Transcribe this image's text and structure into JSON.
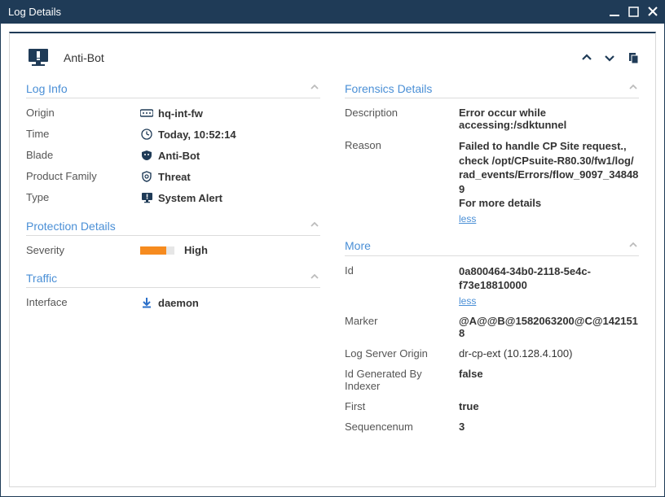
{
  "window": {
    "title": "Log Details"
  },
  "header": {
    "title": "Anti-Bot"
  },
  "sections": {
    "log_info": {
      "title": "Log Info",
      "origin_label": "Origin",
      "origin_value": "hq-int-fw",
      "time_label": "Time",
      "time_value": "Today, 10:52:14",
      "blade_label": "Blade",
      "blade_value": "Anti-Bot",
      "product_family_label": "Product Family",
      "product_family_value": "Threat",
      "type_label": "Type",
      "type_value": "System Alert"
    },
    "protection": {
      "title": "Protection Details",
      "severity_label": "Severity",
      "severity_value": "High"
    },
    "traffic": {
      "title": "Traffic",
      "interface_label": "Interface",
      "interface_value": "daemon"
    },
    "forensics": {
      "title": "Forensics Details",
      "description_label": "Description",
      "description_value": "Error occur while accessing:/sdktunnel",
      "reason_label": "Reason",
      "reason_l1": "Failed to handle CP Site request.,",
      "reason_l2": "check /opt/CPsuite-R80.30/fw1/log/",
      "reason_l3": "rad_events/Errors/flow_9097_348489",
      "reason_l4": "For more details",
      "less": "less"
    },
    "more": {
      "title": "More",
      "id_label": "Id",
      "id_l1": "0a800464-34b0-2118-5e4c-",
      "id_l2": "f73e18810000",
      "less": "less",
      "marker_label": "Marker",
      "marker_value": "@A@@B@1582063200@C@1421518",
      "lso_label": "Log Server Origin",
      "lso_value": "dr-cp-ext (10.128.4.100)",
      "idx_label": "Id Generated By Indexer",
      "idx_value": "false",
      "first_label": "First",
      "first_value": "true",
      "seq_label": "Sequencenum",
      "seq_value": "3"
    }
  }
}
